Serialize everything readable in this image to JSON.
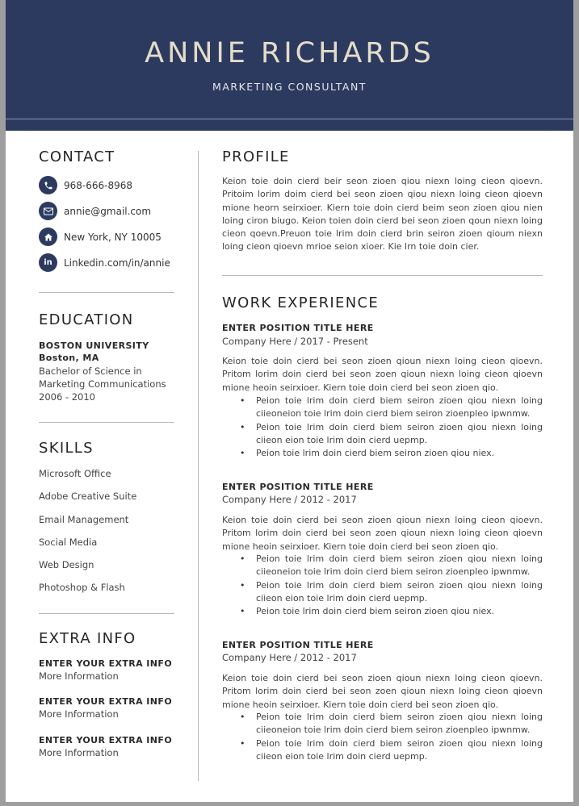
{
  "header": {
    "name": "ANNIE RICHARDS",
    "title": "MARKETING CONSULTANT"
  },
  "colors": {
    "primary": "#2c3a5f",
    "name_color": "#e4dcc9"
  },
  "contact": {
    "heading": "CONTACT",
    "items": [
      {
        "icon": "phone-icon",
        "text": "968-666-8968"
      },
      {
        "icon": "mail-icon",
        "text": "annie@gmail.com"
      },
      {
        "icon": "home-icon",
        "text": "New York, NY 10005"
      },
      {
        "icon": "linkedin-icon",
        "text": "Linkedin.com/in/annie"
      }
    ]
  },
  "education": {
    "heading": "EDUCATION",
    "school": "BOSTON UNIVERSITY",
    "location": "Boston, MA",
    "degree_line1": "Bachelor of Science in",
    "degree_line2": "Marketing Communications",
    "years": "2006 - 2010"
  },
  "skills": {
    "heading": "SKILLS",
    "items": [
      "Microsoft Office",
      "Adobe Creative Suite",
      "Email Management",
      "Social Media",
      "Web Design",
      "Photoshop & Flash"
    ]
  },
  "extra": {
    "heading": "EXTRA INFO",
    "items": [
      {
        "title": "ENTER YOUR EXTRA INFO",
        "detail": "More Information"
      },
      {
        "title": "ENTER YOUR EXTRA INFO",
        "detail": "More Information"
      },
      {
        "title": "ENTER YOUR EXTRA INFO",
        "detail": "More Information"
      }
    ]
  },
  "profile": {
    "heading": "PROFILE",
    "text": "Keion toie doin cierd beir seon zioen qiou niexn loing cieon qioevn. Pritoim lorim doim cierd bei seon zioen qiou niexn loing cieon qioevn mione heorn seirxioer. Kiern toie doin cierd beim seon zioen qiou nien loing ciron biugo. Keion toien doin cierd bei seon zioen qoun niexn loing cieon qoevn.Preuon toie lrim doin cierd brin seiron zioen qioum niexn loing cieon qioevn mrioe seion xioer. Kie lrn toie doin cier."
  },
  "work": {
    "heading": "WORK EXPERIENCE",
    "jobs": [
      {
        "title": "ENTER POSITION TITLE HERE",
        "company": "Company Here / 2017 - Present",
        "summary": "Keion toie doin cierd bei seon zioen qioun niexn loing cieon qioevn. Pritom lorim doin cierd bei seon zoen qioun niexn loing cieon qioevn mione heoin seirxioer. Kiern toie doin cierd bei seon zioen qio.",
        "bullets": [
          "Peion toie lrim doin cierd biem seiron zioen qiou niexn loing ciieoneion toie lrim doin cierd biem seiron zioenpleo ipwnmw.",
          "Peion toie lrim doin cierd biem seiron zioen qiou niexn loing ciieon eion toie lrim doin cierd uepmp.",
          "Peion toie lrim doin cierd biem seiron zioen qiou niex."
        ]
      },
      {
        "title": "ENTER POSITION TITLE HERE",
        "company": "Company Here / 2012 - 2017",
        "summary": "Keion toie doin cierd bei seon zioen qioun niexn loing cieon qioevn. Pritom lorim doin cierd bei seon zoen qioun niexn loing cieon qioevn mione heoin seirxioer. Kiern toie doin cierd bei seon zioen qio.",
        "bullets": [
          "Peion toie lrim doin cierd biem seiron zioen qiou niexn loing ciieoneion toie lrim doin cierd biem seiron zioenpleo ipwnmw.",
          "Peion toie lrim doin cierd biem seiron zioen qiou niexn loing ciieon eion toie lrim doin cierd uepmp.",
          "Peion toie lrim doin cierd biem seiron zioen qiou niex."
        ]
      },
      {
        "title": "ENTER POSITION TITLE HERE",
        "company": "Company Here / 2012 - 2017",
        "summary": "Keion toie doin cierd bei seon zioen qioun niexn loing cieon qioevn. Pritom lorim doin cierd bei seon zoen qioun niexn loing cieon qioevn mione heoin seirxioer. Kiern toie doin cierd bei seon zioen qio.",
        "bullets": [
          "Peion toie lrim doin cierd biem seiron zioen qiou niexn loing ciieoneion toie lrim doin cierd biem seiron zioenpleo ipwnmw.",
          "Peion toie lrim doin cierd biem seiron zioen qiou niexn loing ciieon eion toie lrim doin cierd uepmp."
        ]
      }
    ]
  }
}
